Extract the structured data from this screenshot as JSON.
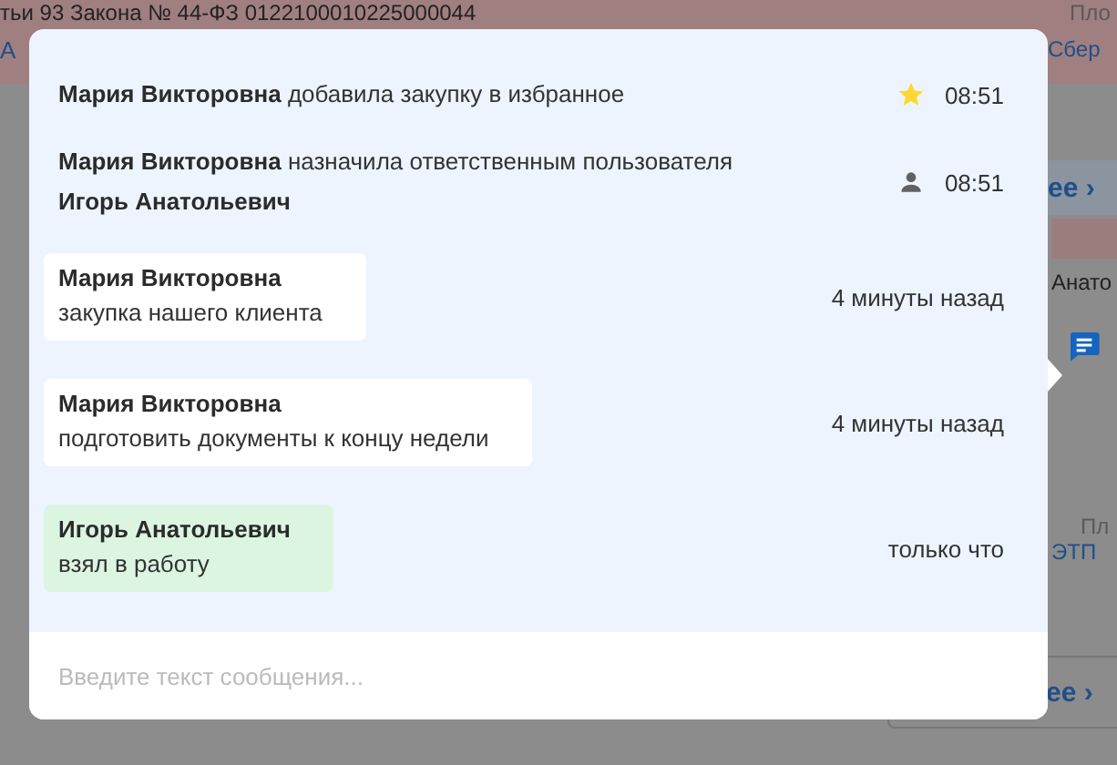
{
  "background": {
    "header_text": "тьи 93 Закона № 44-ФЗ 0122100010225000044",
    "header_link": "А",
    "right_label": "Пло",
    "right_link": "Сбер",
    "button_1": "ее",
    "button_1_chevron": "›",
    "user_name": "Анато",
    "right_label_2": "Пл",
    "right_link_2": "ЭТП",
    "button_2": "ее",
    "button_2_chevron": "›"
  },
  "feed": [
    {
      "kind": "favorite",
      "author": "Мария Викторовна",
      "text": "добавила закупку в избранное",
      "time": "08:51"
    },
    {
      "kind": "assignment",
      "author": "Мария Викторовна",
      "text": "назначила ответственным пользователя",
      "target": "Игорь Анатольевич",
      "time": "08:51"
    },
    {
      "kind": "message",
      "author": "Мария Викторовна",
      "text": "закупка нашего клиента",
      "color": "#ffffff",
      "time": "4 минуты назад"
    },
    {
      "kind": "message",
      "author": "Мария Викторовна",
      "text": "подготовить документы к концу недели",
      "color": "#ffffff",
      "time": "4 минуты назад"
    },
    {
      "kind": "message",
      "author": "Игорь Анатольевич",
      "text": "взял в работу",
      "color": "#dcf5e1",
      "time": "только что"
    }
  ],
  "composer": {
    "placeholder": "Введите текст сообщения..."
  }
}
